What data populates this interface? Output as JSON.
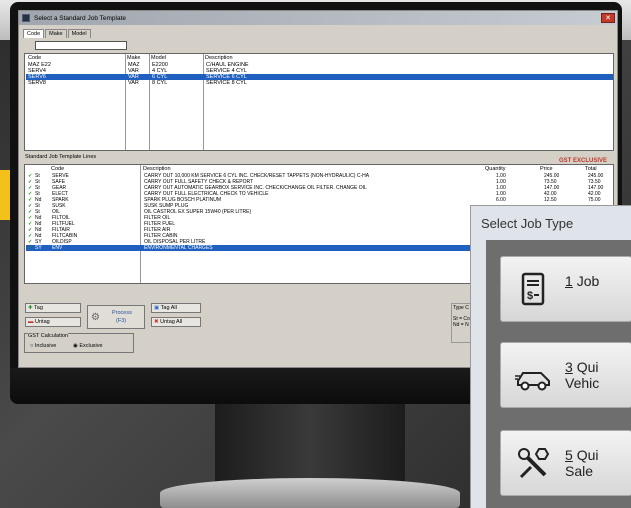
{
  "dialog": {
    "title": "Select a Standard Job Template",
    "tabs": [
      "Code",
      "Make",
      "Model"
    ],
    "code_columns": [
      "Code",
      "Make",
      "Model",
      "Description"
    ],
    "code_rows": [
      {
        "code": "MAZ E22",
        "make": "MAZ",
        "model": "E2200",
        "desc": "C/HAUL ENGINE"
      },
      {
        "code": "SERV4",
        "make": "VAR",
        "model": "4 CYL",
        "desc": "SERVICE 4 CYL"
      },
      {
        "code": "SERV6",
        "make": "VAR",
        "model": "6 CYL",
        "desc": "SERVICE 6 CYL",
        "selected": true
      },
      {
        "code": "SERV8",
        "make": "VAR",
        "model": "8 CYL",
        "desc": "SERVICE 8 CYL"
      }
    ],
    "lines_label": "Standard Job Template Lines",
    "gst_badge": "GST EXCLUSIVE",
    "line_columns": [
      "Code",
      "Description",
      "Quantity",
      "Price",
      "Total"
    ],
    "lines": [
      {
        "flag": "St",
        "code": "SERVE",
        "desc": "CARRY OUT 10,000 KM SERVICE 6 CYL INC. CHECK/RESET TAPPETS (NON-HYDRAULIC) C-HA",
        "qty": "1.00",
        "price": "245.00",
        "total": "245.00"
      },
      {
        "flag": "St",
        "code": "SAFE",
        "desc": "CARRY OUT FULL SAFETY CHECK & REPORT",
        "qty": "1.00",
        "price": "73.50",
        "total": "73.50"
      },
      {
        "flag": "St",
        "code": "GEAR",
        "desc": "CARRY OUT AUTOMATIC GEARBOX SERVICE INC. CHECK/CHANGE OIL FILTER. CHANGE OIL",
        "qty": "1.00",
        "price": "147.00",
        "total": "147.00"
      },
      {
        "flag": "St",
        "code": "ELECT",
        "desc": "CARRY OUT FULL ELECTRICAL CHECK TO VEHICLE",
        "qty": "1.00",
        "price": "42.00",
        "total": "42.00"
      },
      {
        "flag": "Nd",
        "code": "SPARK",
        "desc": "SPARK PLUG BOSCH PLATINUM",
        "qty": "6.00",
        "price": "12.50",
        "total": "75.00"
      },
      {
        "flag": "St",
        "code": "SUSK",
        "desc": "SUSK SUMP PLUG",
        "qty": "",
        "price": "",
        "total": ""
      },
      {
        "flag": "St",
        "code": "OIL",
        "desc": "OIL CASTROL EX SUPER 15W40 (PER LITRE)",
        "qty": "",
        "price": "",
        "total": ""
      },
      {
        "flag": "Nd",
        "code": "FILTOIL",
        "desc": "FILTER OIL",
        "qty": "",
        "price": "",
        "total": ""
      },
      {
        "flag": "Nd",
        "code": "FILTFUEL",
        "desc": "FILTER FUEL",
        "qty": "",
        "price": "",
        "total": ""
      },
      {
        "flag": "Nd",
        "code": "FILTAIR",
        "desc": "FILTER AIR",
        "qty": "",
        "price": "",
        "total": ""
      },
      {
        "flag": "Nd",
        "code": "FILTCABIN",
        "desc": "FILTER CABIN",
        "qty": "",
        "price": "",
        "total": ""
      },
      {
        "flag": "SY",
        "code": "OILDISP",
        "desc": "OIL DISPOSAL PER LITRE",
        "qty": "",
        "price": "",
        "total": ""
      },
      {
        "flag": "SY",
        "code": "ENV",
        "desc": "ENVIRONMENTAL CHARGES",
        "qty": "",
        "price": "",
        "total": "",
        "selected": true
      }
    ],
    "buttons": {
      "tag": "Tag",
      "untag": "Untag",
      "process": "Process",
      "process_key": "(F3)",
      "tag_all": "Tag All",
      "untag_all": "Untag All"
    },
    "gst_calc": {
      "label": "GST Calculation",
      "inclusive": "Inclusive",
      "exclusive": "Exclusive",
      "selected": "exclusive"
    },
    "type_box": {
      "title": "Type C",
      "line1": "St = Com",
      "line2": "Nd = N"
    }
  },
  "job_type": {
    "title": "Select Job Type",
    "options": [
      {
        "key": "1",
        "label_line1": "Job",
        "label_line2": "",
        "icon": "invoice-icon"
      },
      {
        "key": "3",
        "label_line1": "Qui",
        "label_line2": "Vehic",
        "icon": "car-icon"
      },
      {
        "key": "5",
        "label_line1": "Qui",
        "label_line2": "Sale",
        "icon": "wrench-bolt-icon"
      }
    ]
  }
}
